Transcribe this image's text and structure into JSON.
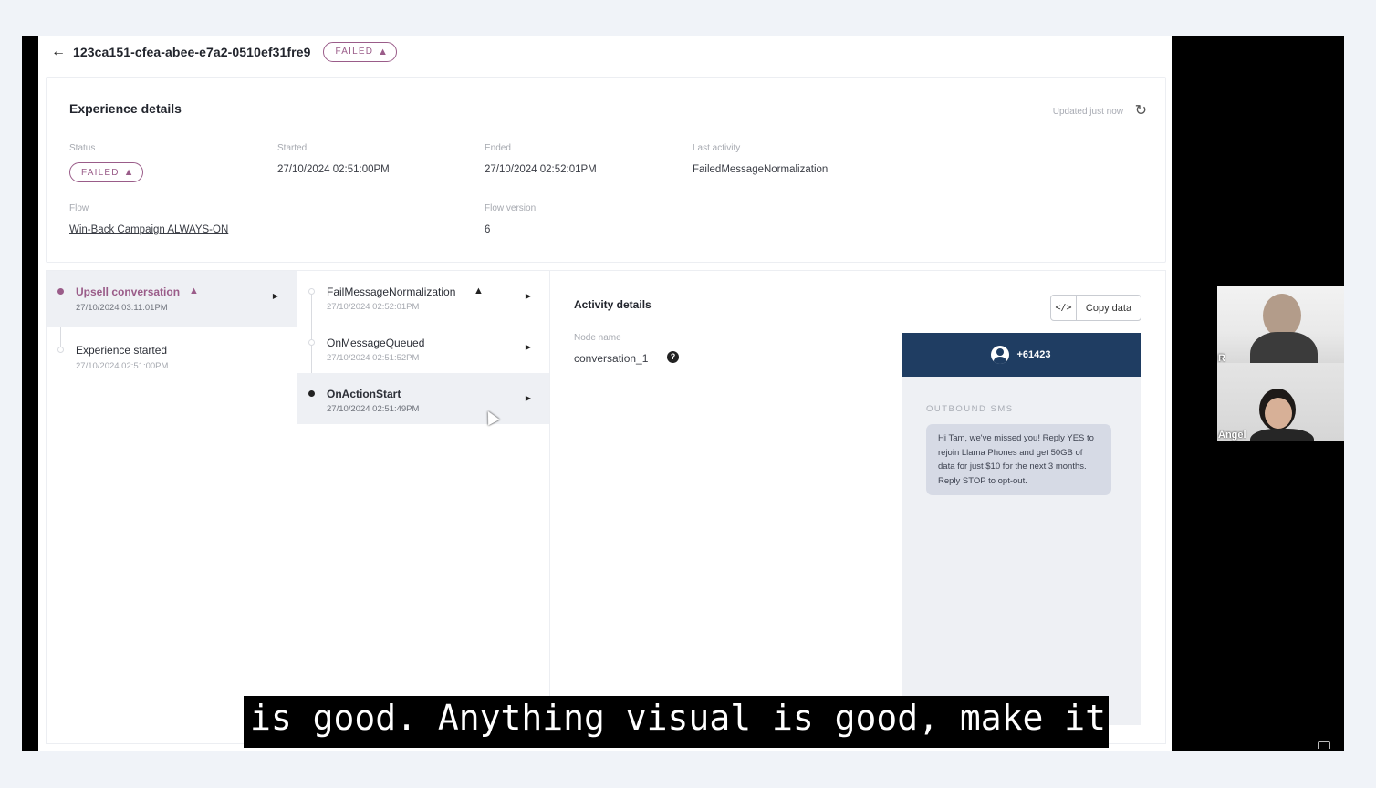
{
  "header": {
    "experience_id": "123ca151-cfea-abee-e7a2-0510ef31fre9",
    "status": "FAILED"
  },
  "details": {
    "title": "Experience details",
    "updated": "Updated just now",
    "status_label": "Status",
    "status_value": "FAILED",
    "started_label": "Started",
    "started_value": "27/10/2024 02:51:00PM",
    "ended_label": "Ended",
    "ended_value": "27/10/2024 02:52:01PM",
    "last_activity_label": "Last activity",
    "last_activity_value": "FailedMessageNormalization",
    "flow_label": "Flow",
    "flow_value": "Win-Back Campaign ALWAYS-ON",
    "flow_version_label": "Flow version",
    "flow_version_value": "6"
  },
  "timeline": [
    {
      "title": "Upsell conversation",
      "time": "27/10/2024 03:11:01PM",
      "warning": true
    },
    {
      "title": "Experience started",
      "time": "27/10/2024 02:51:00PM",
      "warning": false
    }
  ],
  "activities": [
    {
      "title": "FailMessageNormalization",
      "time": "27/10/2024 02:52:01PM",
      "warning": true
    },
    {
      "title": "OnMessageQueued",
      "time": "27/10/2024 02:51:52PM",
      "warning": false
    },
    {
      "title": "OnActionStart",
      "time": "27/10/2024 02:51:49PM",
      "warning": false
    }
  ],
  "activity_details": {
    "title": "Activity details",
    "copy_label": "Copy data",
    "node_label": "Node name",
    "node_value": "conversation_1",
    "phone_number": "+61423",
    "channel_label": "OUTBOUND SMS",
    "message": "Hi Tam, we've missed you! Reply YES to rejoin Llama Phones and get 50GB of data for just $10 for the next 3 months. Reply STOP to opt-out."
  },
  "participants": [
    {
      "name": "R"
    },
    {
      "name": "Angel"
    }
  ],
  "caption": "is good. Anything visual is good, make it",
  "colors": {
    "failed": "#9a5c89",
    "phone_header": "#1f3d62",
    "bubble": "#d6dae5"
  }
}
